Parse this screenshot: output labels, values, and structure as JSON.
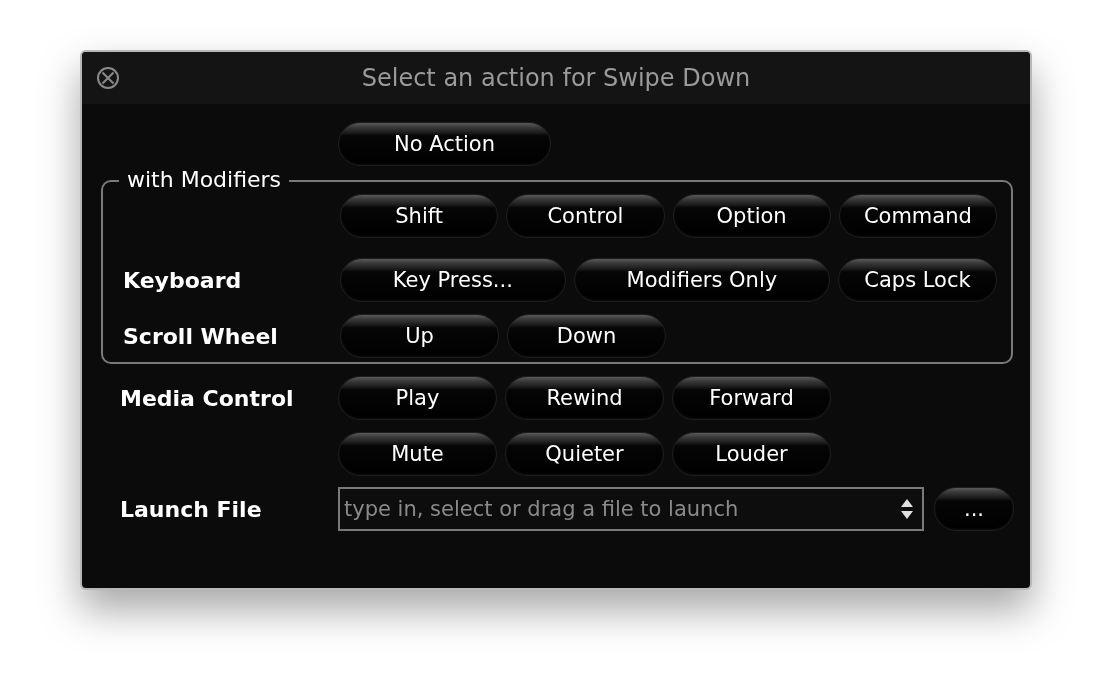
{
  "window": {
    "title": "Select an action for Swipe Down"
  },
  "no_action": "No Action",
  "modifiers": {
    "legend": "with Modifiers",
    "rows": [
      {
        "buttons": [
          "Shift",
          "Control",
          "Option",
          "Command"
        ]
      },
      {
        "label": "Keyboard",
        "buttons": [
          "Key Press...",
          "Modifiers Only",
          "Caps Lock"
        ]
      },
      {
        "label": "Scroll Wheel",
        "buttons": [
          "Up",
          "Down"
        ]
      }
    ]
  },
  "media": [
    {
      "label": "Media Control",
      "buttons": [
        "Play",
        "Rewind",
        "Forward"
      ]
    },
    {
      "buttons": [
        "Mute",
        "Quieter",
        "Louder"
      ]
    }
  ],
  "launch": {
    "label": "Launch File",
    "placeholder": "type in, select or drag a file to launch",
    "browse": "..."
  }
}
